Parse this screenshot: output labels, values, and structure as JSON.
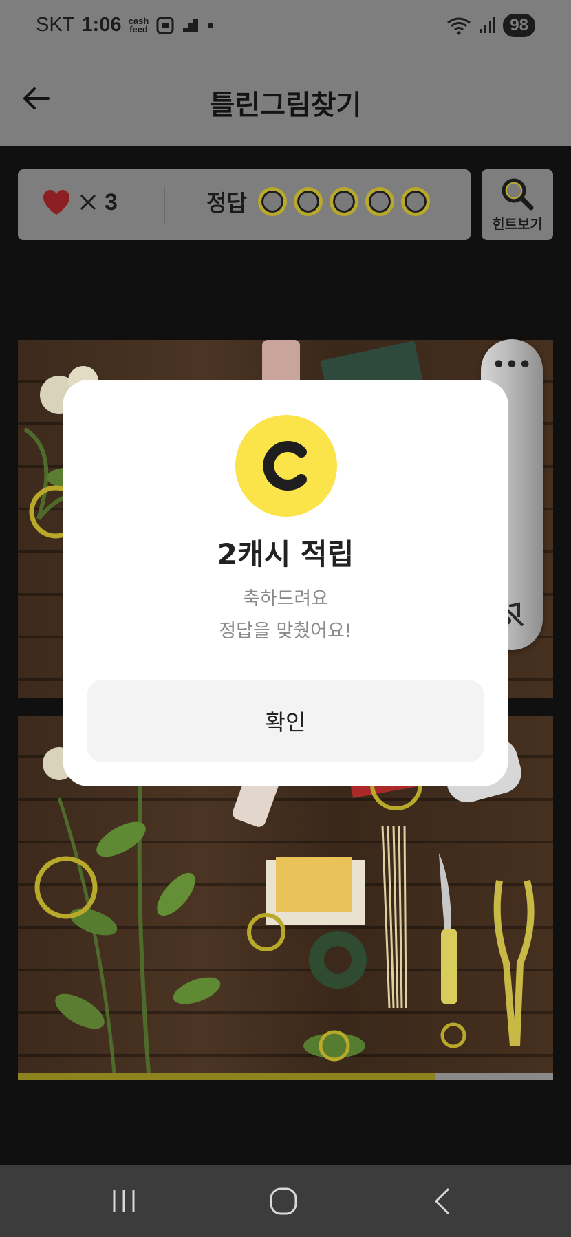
{
  "status_bar": {
    "carrier": "SKT",
    "time": "1:06",
    "cashfeed_icon": "cash feed",
    "battery": "98",
    "icons": [
      "cashfeed-icon",
      "screenshot-icon",
      "stairs-icon",
      "dot-icon",
      "wifi-icon",
      "signal-icon"
    ]
  },
  "header": {
    "title": "틀린그림찾기",
    "back_icon": "arrow-left-icon"
  },
  "info_bar": {
    "lives_icon": "heart-icon",
    "lives_count": "3",
    "answer_label": "정답",
    "answer_slots_total": 5,
    "answer_slots_found": 0,
    "accent_color": "#b8a92a"
  },
  "hint": {
    "label": "힌트보기",
    "icon": "magnifier-icon"
  },
  "progress": {
    "fraction": 0.78,
    "fill_color": "#8d8420"
  },
  "side_panel": {
    "more_icon": "more-dots-icon",
    "sound_icon": "music-off-icon"
  },
  "modal": {
    "coin_letter": "C",
    "title": "2캐시 적립",
    "message_line1": "축하드려요",
    "message_line2": "정답을 맞췄어요!",
    "confirm_label": "확인",
    "coin_color": "#fae44a"
  },
  "nav_bar": {
    "icons": [
      "recent-apps-icon",
      "home-icon",
      "back-nav-icon"
    ]
  }
}
